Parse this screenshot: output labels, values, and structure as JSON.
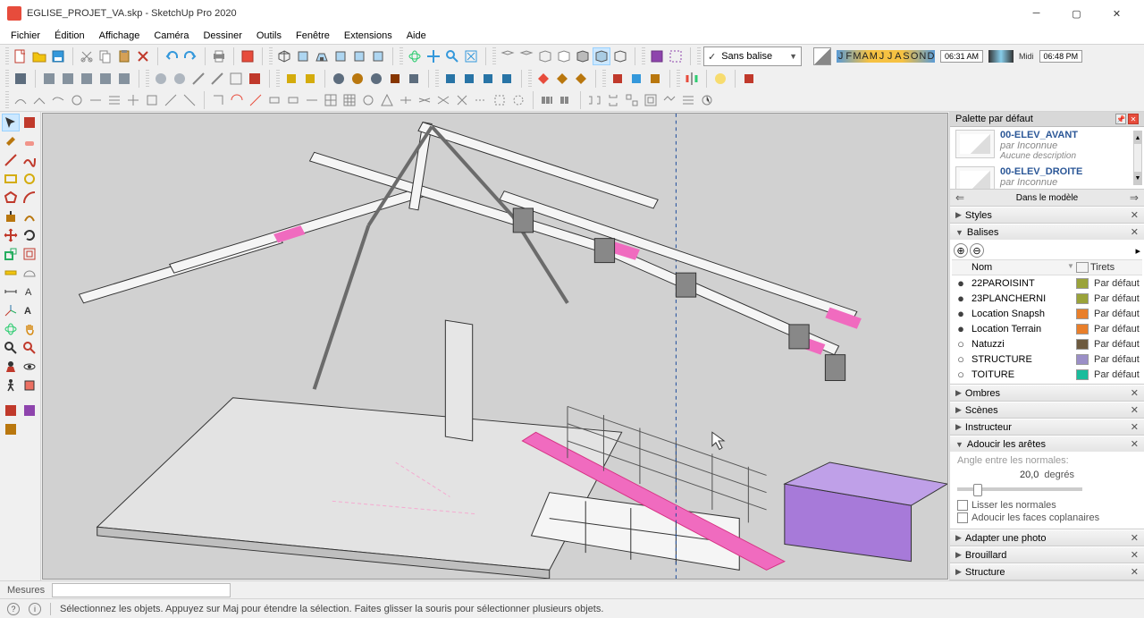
{
  "window": {
    "title": "EGLISE_PROJET_VA.skp - SketchUp Pro 2020"
  },
  "menubar": [
    "Fichier",
    "Édition",
    "Affichage",
    "Caméra",
    "Dessiner",
    "Outils",
    "Fenêtre",
    "Extensions",
    "Aide"
  ],
  "toolbar_row1": {
    "layer_dropdown": "Sans balise",
    "shadow": {
      "months": [
        "J",
        "F",
        "M",
        "A",
        "M",
        "J",
        "J",
        "A",
        "S",
        "O",
        "N",
        "D"
      ],
      "time_start": "06:31 AM",
      "time_mid": "Midi",
      "time_end": "06:48 PM"
    }
  },
  "right": {
    "tray_title": "Palette par défaut",
    "scenes": [
      {
        "name": "00-ELEV_AVANT",
        "by": "par",
        "author": "Inconnue",
        "desc": "Aucune description"
      },
      {
        "name": "00-ELEV_DROITE",
        "by": "par",
        "author": "Inconnue",
        "desc": ""
      }
    ],
    "nav_label": "Dans le modèle",
    "panels": {
      "styles": "Styles",
      "balises": "Balises",
      "ombres": "Ombres",
      "scenes": "Scènes",
      "instructeur": "Instructeur",
      "adoucir": "Adoucir les arêtes",
      "adapter": "Adapter une photo",
      "brouillard": "Brouillard",
      "structure": "Structure"
    },
    "tags": {
      "headers": {
        "name": "Nom",
        "dash": "Tirets"
      },
      "rows": [
        {
          "visible": true,
          "name": "22PAROISINT",
          "color": "#9aa33a",
          "dash": "Par défaut"
        },
        {
          "visible": true,
          "name": "23PLANCHERNI",
          "color": "#9aa33a",
          "dash": "Par défaut"
        },
        {
          "visible": true,
          "name": "Location Snapsh",
          "color": "#e97f2b",
          "dash": "Par défaut"
        },
        {
          "visible": true,
          "name": "Location Terrain",
          "color": "#e97f2b",
          "dash": "Par défaut"
        },
        {
          "visible": false,
          "name": "Natuzzi",
          "color": "#6d5a3f",
          "dash": "Par défaut"
        },
        {
          "visible": false,
          "name": "STRUCTURE",
          "color": "#9b8fc7",
          "dash": "Par défaut"
        },
        {
          "visible": false,
          "name": "TOITURE",
          "color": "#1abc9c",
          "dash": "Par défaut"
        }
      ]
    },
    "soften": {
      "angle_label": "Angle entre les normales:",
      "value": "20,0",
      "unit": "degrés",
      "cb1": "Lisser les normales",
      "cb2": "Adoucir les faces coplanaires"
    }
  },
  "measure": {
    "label": "Mesures"
  },
  "status": {
    "text": "Sélectionnez les objets. Appuyez sur Maj pour étendre la sélection. Faites glisser la souris pour sélectionner plusieurs objets."
  }
}
